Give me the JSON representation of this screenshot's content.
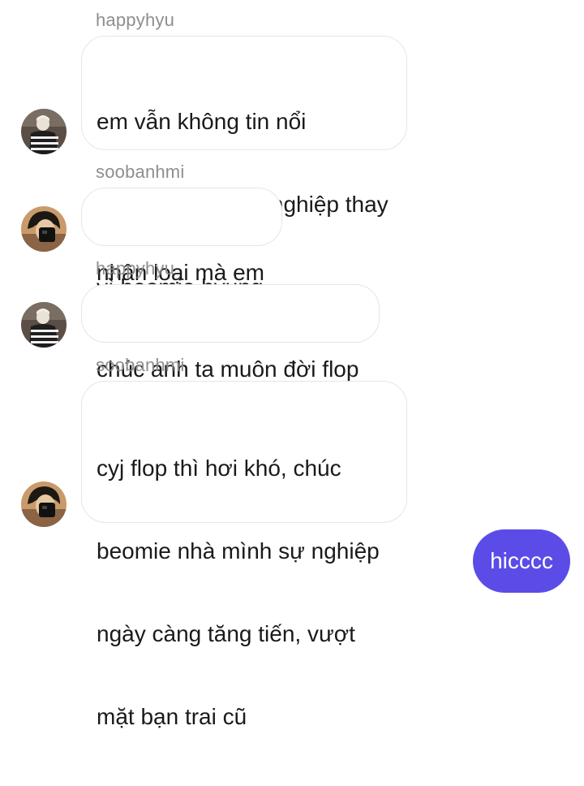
{
  "messages": [
    {
      "sender": "happyhyu",
      "lines": [
        "em vẫn không tin nổi",
        "yeonjun chọn sự nghiệp thay",
        "vì beomie hyung"
      ],
      "avatar": "avatar-happyhyu-icon"
    },
    {
      "sender": "soobanhmi",
      "lines": [
        "nhân loại mà em"
      ],
      "avatar": "avatar-soobanhmi-icon"
    },
    {
      "sender": "happyhyu",
      "lines": [
        "chúc anh ta muôn đời flop"
      ],
      "avatar": "avatar-happyhyu-icon"
    },
    {
      "sender": "soobanhmi",
      "lines": [
        "cyj flop thì hơi khó, chúc",
        "beomie nhà mình sự nghiệp",
        "ngày càng tăng tiến, vượt",
        "mặt bạn trai cũ"
      ],
      "avatar": "avatar-soobanhmi-icon"
    }
  ],
  "outgoing": {
    "text": "hicccc",
    "color": "#5b4ce8"
  }
}
